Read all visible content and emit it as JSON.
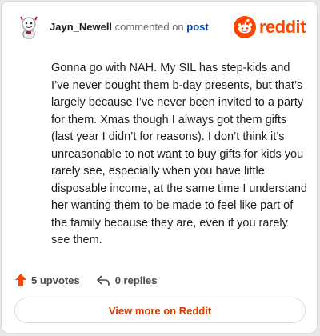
{
  "header": {
    "author": "Jayn_Newell",
    "action": "commented on",
    "post_link": "post",
    "brand": "reddit",
    "avatar_icon": "snoo-avatar-icon",
    "brand_icon": "reddit-snoo-logo-icon"
  },
  "comment": {
    "text": "Gonna go with NAH. My SIL has step-kids and I’ve never bought them b-day presents, but that’s largely because I’ve never been invited to a party for them. Xmas though I always got them gifts (last year I didn’t for reasons). I don’t think it’s unreasonable to not want to buy gifts for kids you rarely see, especially when you have little disposable income, at the same time I understand her wanting them to be made to feel like part of the family because they are, even if you rarely see them."
  },
  "footer": {
    "upvotes": "5 upvotes",
    "replies": "0 replies",
    "upvote_icon": "upvote-arrow-icon",
    "reply_icon": "reply-arrow-icon"
  },
  "view_more_label": "View more on Reddit",
  "colors": {
    "brand": "#ff4500",
    "link": "#0045ac",
    "upvote": "#ff4500",
    "button_text": "#d93900"
  }
}
